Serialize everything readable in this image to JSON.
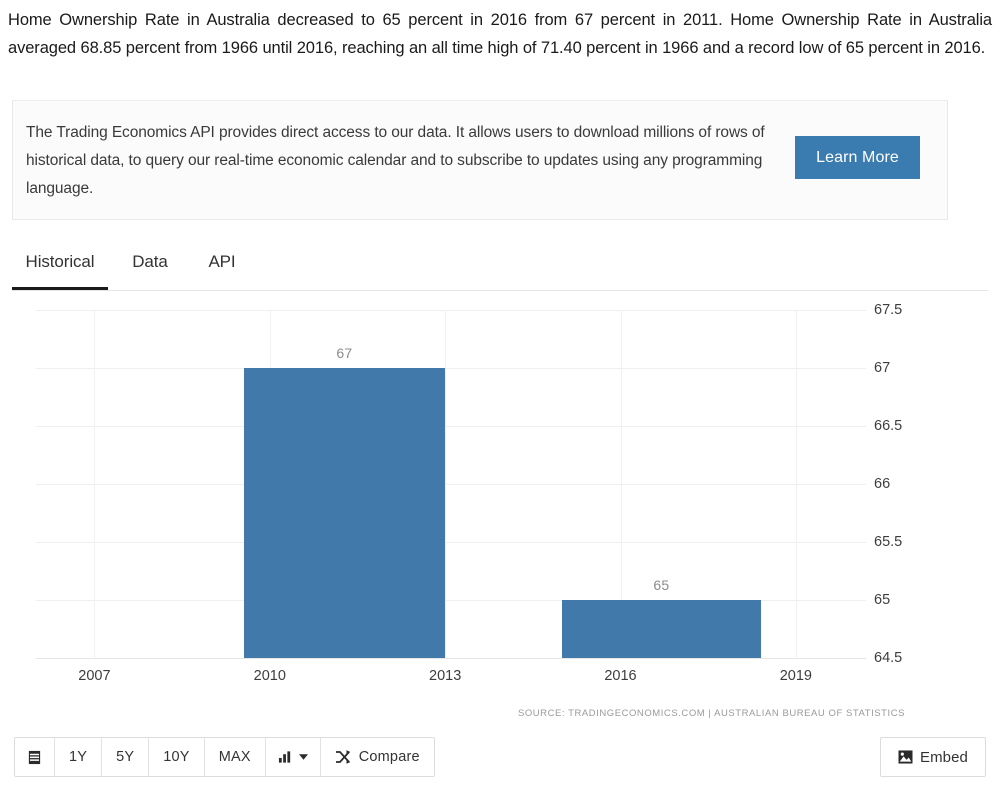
{
  "intro": {
    "paragraph": "Home Ownership Rate in Australia decreased to 65 percent in 2016 from 67 percent in 2011. Home Ownership Rate in Australia averaged 68.85 percent from 1966 until 2016, reaching an all time high of 71.40 percent in 1966 and a record low of 65 percent in 2016."
  },
  "promo": {
    "text": "The Trading Economics API provides direct access to our data. It allows users to download millions of rows of historical data, to query our real-time economic calendar and to subscribe to updates using any programming language.",
    "button_label": "Learn More",
    "button_color": "#3a7cb0"
  },
  "tabs": [
    {
      "label": "Historical",
      "active": true
    },
    {
      "label": "Data",
      "active": false
    },
    {
      "label": "API",
      "active": false
    }
  ],
  "chart_data": {
    "type": "bar",
    "title": "",
    "xlabel": "",
    "ylabel": "",
    "categories": [
      "2011",
      "2016"
    ],
    "values": [
      67,
      65
    ],
    "data_labels": [
      "67",
      "65"
    ],
    "series": [
      {
        "name": "Home Ownership Rate",
        "values": [
          67,
          65
        ]
      }
    ],
    "ylim": [
      64.5,
      67.5
    ],
    "yticks": [
      "67.5",
      "67",
      "66.5",
      "66",
      "65.5",
      "65",
      "64.5"
    ],
    "ytick_values": [
      67.5,
      67,
      66.5,
      66,
      65.5,
      65,
      64.5
    ],
    "xticks": [
      "2007",
      "2010",
      "2013",
      "2016",
      "2019"
    ],
    "xtick_values": [
      2007,
      2010,
      2013,
      2016,
      2019
    ],
    "grid": true,
    "legend": "none",
    "bar_color": "#4279ab",
    "source": "SOURCE: TRADINGECONOMICS.COM  |  AUSTRALIAN BUREAU OF STATISTICS"
  },
  "toolbar": {
    "calendar_label": "",
    "ranges": [
      "1Y",
      "5Y",
      "10Y",
      "MAX"
    ],
    "chart_type_label": "",
    "compare_label": "Compare",
    "embed_label": "Embed"
  }
}
